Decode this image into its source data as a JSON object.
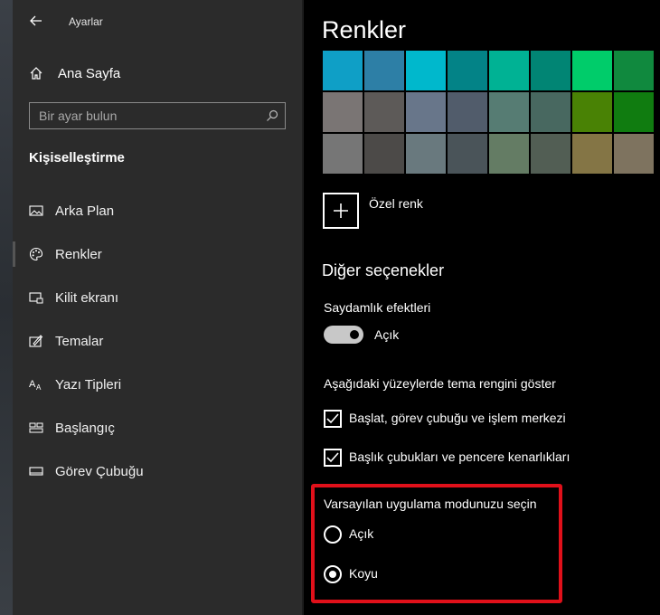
{
  "window": {
    "title": "Ayarlar"
  },
  "sidebar": {
    "home_label": "Ana Sayfa",
    "search_placeholder": "Bir ayar bulun",
    "section_title": "Kişiselleştirme",
    "items": [
      {
        "label": "Arka Plan",
        "icon": "image-icon"
      },
      {
        "label": "Renkler",
        "icon": "palette-icon",
        "selected": true
      },
      {
        "label": "Kilit ekranı",
        "icon": "lock-screen-icon"
      },
      {
        "label": "Temalar",
        "icon": "themes-icon"
      },
      {
        "label": "Yazı Tipleri",
        "icon": "fonts-icon"
      },
      {
        "label": "Başlangıç",
        "icon": "start-icon"
      },
      {
        "label": "Görev Çubuğu",
        "icon": "taskbar-icon"
      }
    ]
  },
  "main": {
    "title": "Renkler",
    "swatches": [
      "#0f9fc6",
      "#2d7fa6",
      "#00b8cc",
      "#038387",
      "#00b294",
      "#018574",
      "#00cc6a",
      "#10893e",
      "#7a7574",
      "#5d5a58",
      "#68768a",
      "#515c6b",
      "#567c73",
      "#486860",
      "#498205",
      "#107c10",
      "#767676",
      "#4c4a48",
      "#69797e",
      "#4a5459",
      "#647c64",
      "#525e54",
      "#847545",
      "#7e735f"
    ],
    "custom_color_label": "Özel renk",
    "other_options_heading": "Diğer seçenekler",
    "transparency": {
      "label": "Saydamlık efektleri",
      "state": "Açık",
      "on": true
    },
    "accent_surfaces_label": "Aşağıdaki yüzeylerde tema rengini göster",
    "checkboxes": [
      {
        "label": "Başlat, görev çubuğu ve işlem merkezi",
        "checked": true
      },
      {
        "label": "Başlık çubukları ve pencere kenarlıkları",
        "checked": true
      }
    ],
    "app_mode": {
      "label": "Varsayılan uygulama modunuzu seçin",
      "options": [
        {
          "label": "Açık",
          "selected": false
        },
        {
          "label": "Koyu",
          "selected": true
        }
      ]
    }
  },
  "colors": {
    "highlight": "#e0101a",
    "sidebar_bg": "#2b2b2b",
    "main_bg": "#000000"
  }
}
